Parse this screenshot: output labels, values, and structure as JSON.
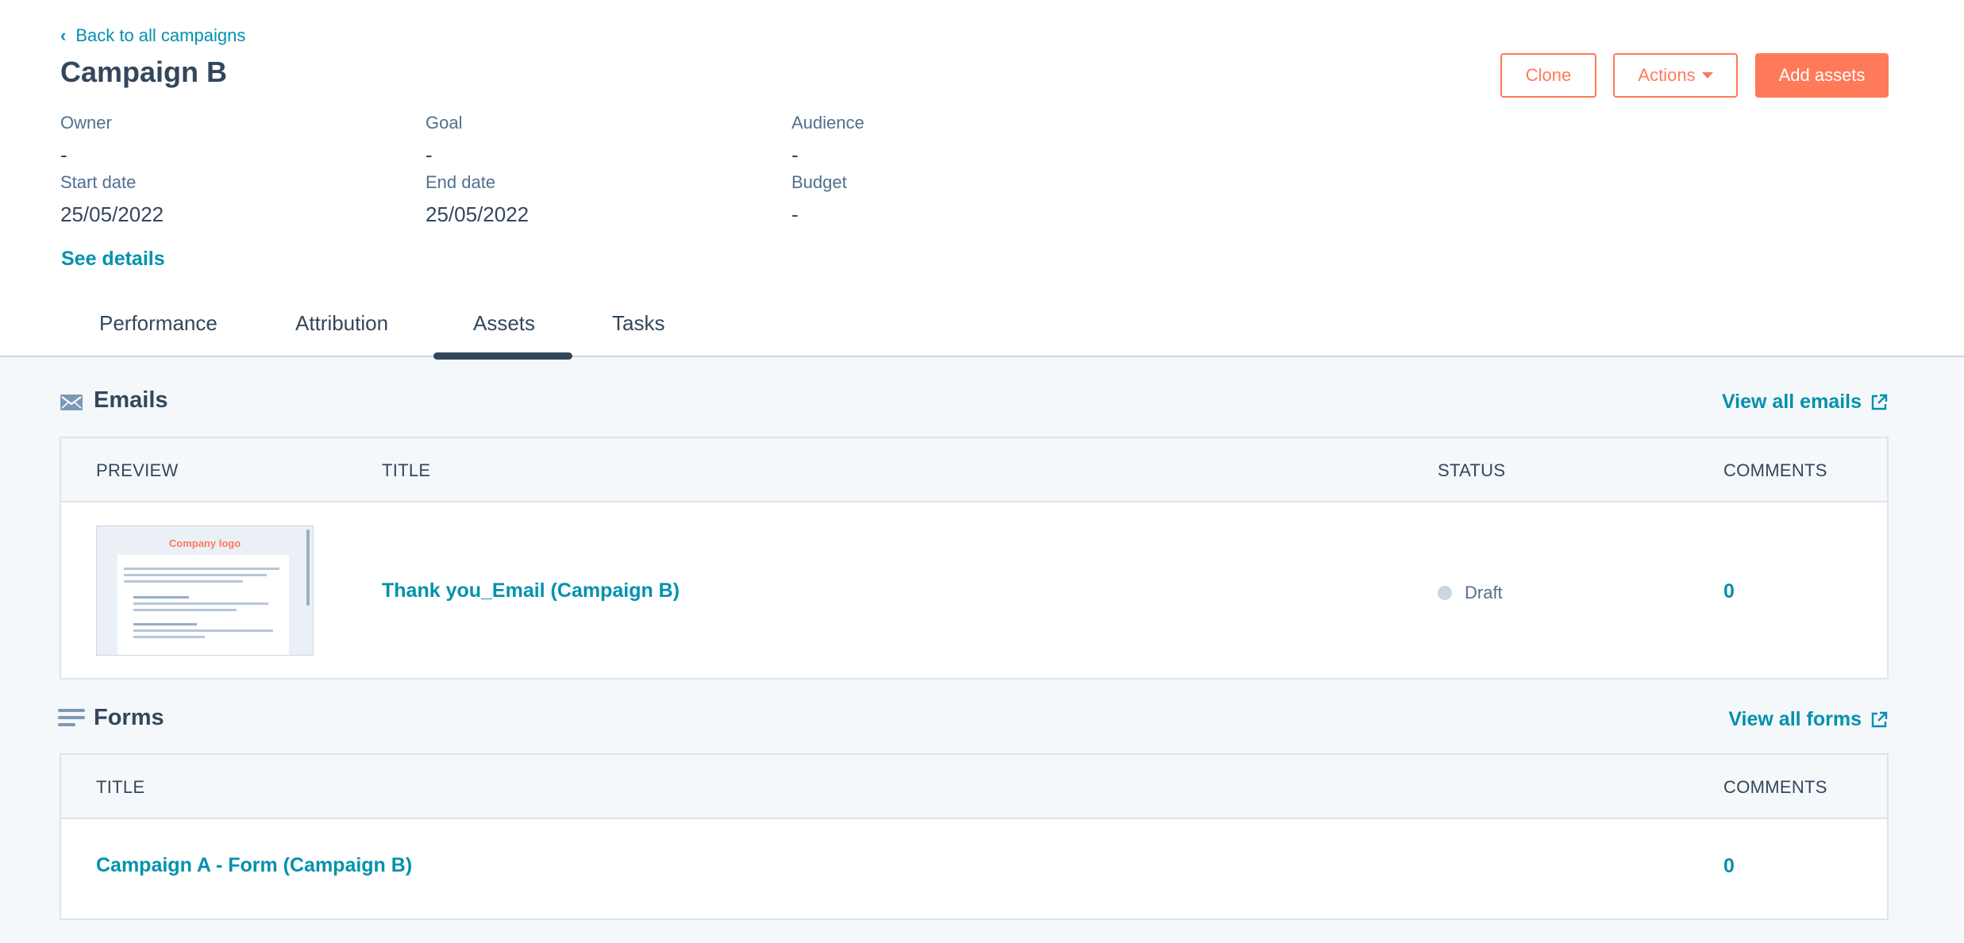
{
  "header": {
    "back_label": "Back to all campaigns",
    "title": "Campaign B",
    "buttons": {
      "clone": "Clone",
      "actions": "Actions",
      "add_assets": "Add assets"
    }
  },
  "details": {
    "owner_label": "Owner",
    "owner_value": "-",
    "goal_label": "Goal",
    "goal_value": "-",
    "audience_label": "Audience",
    "audience_value": "-",
    "start_label": "Start date",
    "start_value": "25/05/2022",
    "end_label": "End date",
    "end_value": "25/05/2022",
    "budget_label": "Budget",
    "budget_value": "-",
    "see_details": "See details"
  },
  "tabs": [
    {
      "label": "Performance",
      "active": false
    },
    {
      "label": "Attribution",
      "active": false
    },
    {
      "label": "Assets",
      "active": true
    },
    {
      "label": "Tasks",
      "active": false
    }
  ],
  "emails": {
    "section_icon": "envelope-icon",
    "title": "Emails",
    "view_all": "View all emails",
    "columns": {
      "preview": "PREVIEW",
      "title": "TITLE",
      "status": "STATUS",
      "comments": "COMMENTS"
    },
    "rows": [
      {
        "preview_logo": "Company logo",
        "title": "Thank you_Email (Campaign B)",
        "status": "Draft",
        "comments": "0"
      }
    ]
  },
  "forms": {
    "section_icon": "list-lines-icon",
    "title": "Forms",
    "view_all": "View all forms",
    "columns": {
      "title": "TITLE",
      "comments": "COMMENTS"
    },
    "rows": [
      {
        "title": "Campaign A - Form (Campaign B)",
        "comments": "0"
      }
    ]
  },
  "colors": {
    "accent": "#ff7a59",
    "link": "#0091ae",
    "text": "#33475b",
    "status_draft": "#cbd6e2"
  }
}
